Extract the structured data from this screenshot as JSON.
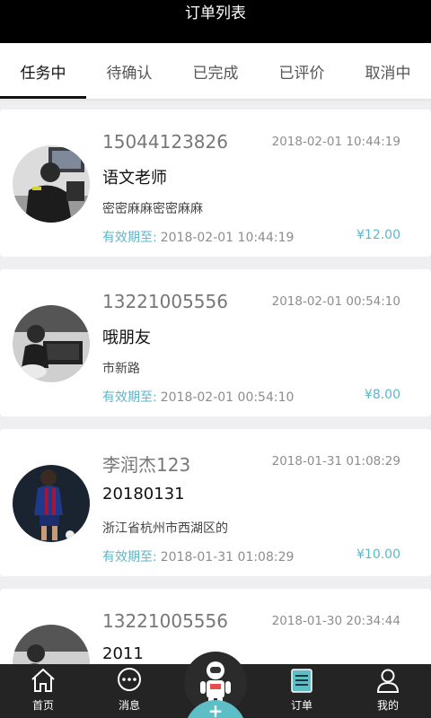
{
  "header": {
    "title": "订单列表"
  },
  "tabs": [
    {
      "label": "任务中"
    },
    {
      "label": "待确认"
    },
    {
      "label": "已完成"
    },
    {
      "label": "已评价"
    },
    {
      "label": "取消中"
    }
  ],
  "orders": [
    {
      "phone": "15044123826",
      "time": "2018-02-01 10:44:19",
      "name": "语文老师",
      "address": "密密麻麻密密麻麻",
      "valid_label": "有效期至:",
      "valid_date": "2018-02-01 10:44:19",
      "price": "¥12.00"
    },
    {
      "phone": "13221005556",
      "time": "2018-02-01 00:54:10",
      "name": "哦朋友",
      "address": "市新路",
      "valid_label": "有效期至:",
      "valid_date": "2018-02-01 00:54:10",
      "price": "¥8.00"
    },
    {
      "phone": "李润杰123",
      "time": "2018-01-31 01:08:29",
      "name": "20180131",
      "address": "浙江省杭州市西湖区的",
      "valid_label": "有效期至:",
      "valid_date": "2018-01-31 01:08:29",
      "price": "¥10.00"
    },
    {
      "phone": "13221005556",
      "time": "2018-01-30 20:34:44",
      "name": "2011",
      "address": "",
      "valid_label": "",
      "valid_date": "",
      "price": ""
    }
  ],
  "tabbar": {
    "home": "首页",
    "messages": "消息",
    "orders": "订单",
    "mine": "我的",
    "plus": "+"
  },
  "colors": {
    "accent": "#5cb7c8",
    "header_bg": "#000000",
    "tabbar_bg": "#242424"
  }
}
